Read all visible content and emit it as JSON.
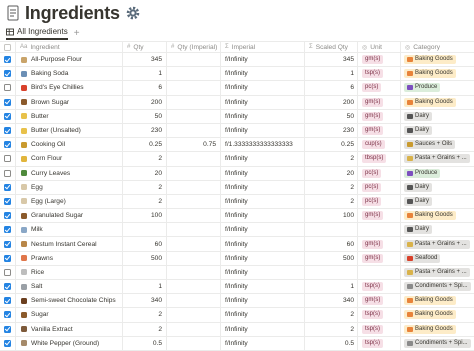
{
  "page": {
    "title": "Ingredients",
    "title_icon": "gear-icon",
    "page_icon": "database-page-icon"
  },
  "tabs": {
    "active_label": "All Ingredients",
    "add_symbol": "+"
  },
  "columns": {
    "ingredient": "Ingredient",
    "qty": "Qty",
    "qty_imperial": "Qty (Imperial)",
    "imperial": "Imperial",
    "scaled_qty": "Scaled Qty",
    "unit": "Unit",
    "category": "Category"
  },
  "category_colors": {
    "Baking Goods": "#fdecc8",
    "Produce": "#dbeddb",
    "Dairy": "#e3e2e0",
    "Sauces + Oils": "#e3e2e0",
    "Pasta + Grains + ...": "#e3e2e0",
    "Seafood": "#e3e2e0",
    "Condiments + Spi...": "#e3e2e0"
  },
  "rows": [
    {
      "checked": true,
      "ingredient": "All-Purpose Flour",
      "qty": "345",
      "qty_imperial": "",
      "imperial": "f/Infinity",
      "scaled_qty": "345",
      "unit": "gm(s)",
      "category": "Baking Goods",
      "food_icon": "flour-icon"
    },
    {
      "checked": true,
      "ingredient": "Baking Soda",
      "qty": "1",
      "qty_imperial": "",
      "imperial": "f/Infinity",
      "scaled_qty": "1",
      "unit": "tsp(s)",
      "category": "Baking Goods",
      "food_icon": "soda-icon"
    },
    {
      "checked": false,
      "ingredient": "Bird's Eye Chillies",
      "qty": "6",
      "qty_imperial": "",
      "imperial": "f/Infinity",
      "scaled_qty": "6",
      "unit": "pc(s)",
      "category": "Produce",
      "food_icon": "chilli-icon"
    },
    {
      "checked": true,
      "ingredient": "Brown Sugar",
      "qty": "200",
      "qty_imperial": "",
      "imperial": "f/Infinity",
      "scaled_qty": "200",
      "unit": "gm(s)",
      "category": "Baking Goods",
      "food_icon": "sugar-icon"
    },
    {
      "checked": true,
      "ingredient": "Butter",
      "qty": "50",
      "qty_imperial": "",
      "imperial": "f/Infinity",
      "scaled_qty": "50",
      "unit": "gm(s)",
      "category": "Dairy",
      "food_icon": "butter-icon"
    },
    {
      "checked": true,
      "ingredient": "Butter (Unsalted)",
      "qty": "230",
      "qty_imperial": "",
      "imperial": "f/Infinity",
      "scaled_qty": "230",
      "unit": "gm(s)",
      "category": "Dairy",
      "food_icon": "butter-icon"
    },
    {
      "checked": true,
      "ingredient": "Cooking Oil",
      "qty": "0.25",
      "qty_imperial": "0.75",
      "imperial": "f/1.3333333333333333",
      "scaled_qty": "0.25",
      "unit": "cup(s)",
      "category": "Sauces + Oils",
      "food_icon": "oil-icon"
    },
    {
      "checked": false,
      "ingredient": "Corn Flour",
      "qty": "2",
      "qty_imperial": "",
      "imperial": "f/Infinity",
      "scaled_qty": "2",
      "unit": "tbsp(s)",
      "category": "Pasta + Grains + ...",
      "food_icon": "corn-icon"
    },
    {
      "checked": false,
      "ingredient": "Curry Leaves",
      "qty": "20",
      "qty_imperial": "",
      "imperial": "f/Infinity",
      "scaled_qty": "20",
      "unit": "pc(s)",
      "category": "Produce",
      "food_icon": "leaf-icon"
    },
    {
      "checked": true,
      "ingredient": "Egg",
      "qty": "2",
      "qty_imperial": "",
      "imperial": "f/Infinity",
      "scaled_qty": "2",
      "unit": "pc(s)",
      "category": "Dairy",
      "food_icon": "egg-icon"
    },
    {
      "checked": true,
      "ingredient": "Egg (Large)",
      "qty": "2",
      "qty_imperial": "",
      "imperial": "f/Infinity",
      "scaled_qty": "2",
      "unit": "pc(s)",
      "category": "Dairy",
      "food_icon": "egg-icon"
    },
    {
      "checked": true,
      "ingredient": "Granulated Sugar",
      "qty": "100",
      "qty_imperial": "",
      "imperial": "f/Infinity",
      "scaled_qty": "100",
      "unit": "gm(s)",
      "category": "Baking Goods",
      "food_icon": "sugar-icon"
    },
    {
      "checked": true,
      "ingredient": "Milk",
      "qty": "",
      "qty_imperial": "",
      "imperial": "f/Infinity",
      "scaled_qty": "",
      "unit": "",
      "category": "Dairy",
      "food_icon": "milk-icon"
    },
    {
      "checked": true,
      "ingredient": "Nestum Instant Cereal",
      "qty": "60",
      "qty_imperial": "",
      "imperial": "f/Infinity",
      "scaled_qty": "60",
      "unit": "gm(s)",
      "category": "Pasta + Grains + ...",
      "food_icon": "cereal-icon"
    },
    {
      "checked": true,
      "ingredient": "Prawns",
      "qty": "500",
      "qty_imperial": "",
      "imperial": "f/Infinity",
      "scaled_qty": "500",
      "unit": "gm(s)",
      "category": "Seafood",
      "food_icon": "prawn-icon"
    },
    {
      "checked": false,
      "ingredient": "Rice",
      "qty": "",
      "qty_imperial": "",
      "imperial": "f/Infinity",
      "scaled_qty": "",
      "unit": "",
      "category": "Pasta + Grains + ...",
      "food_icon": "rice-icon"
    },
    {
      "checked": true,
      "ingredient": "Salt",
      "qty": "1",
      "qty_imperial": "",
      "imperial": "f/Infinity",
      "scaled_qty": "1",
      "unit": "tsp(s)",
      "category": "Condiments + Spi...",
      "food_icon": "salt-icon"
    },
    {
      "checked": true,
      "ingredient": "Semi-sweet Chocolate Chips",
      "qty": "340",
      "qty_imperial": "",
      "imperial": "f/Infinity",
      "scaled_qty": "340",
      "unit": "gm(s)",
      "category": "Baking Goods",
      "food_icon": "chocolate-icon"
    },
    {
      "checked": true,
      "ingredient": "Sugar",
      "qty": "2",
      "qty_imperial": "",
      "imperial": "f/Infinity",
      "scaled_qty": "2",
      "unit": "tsp(s)",
      "category": "Baking Goods",
      "food_icon": "sugar-icon"
    },
    {
      "checked": true,
      "ingredient": "Vanilla Extract",
      "qty": "2",
      "qty_imperial": "",
      "imperial": "f/Infinity",
      "scaled_qty": "2",
      "unit": "tsp(s)",
      "category": "Baking Goods",
      "food_icon": "vanilla-icon"
    },
    {
      "checked": true,
      "ingredient": "White Pepper (Ground)",
      "qty": "0.5",
      "qty_imperial": "",
      "imperial": "f/Infinity",
      "scaled_qty": "0.5",
      "unit": "tsp(s)",
      "category": "Condiments + Spi...",
      "food_icon": "pepper-icon"
    }
  ]
}
